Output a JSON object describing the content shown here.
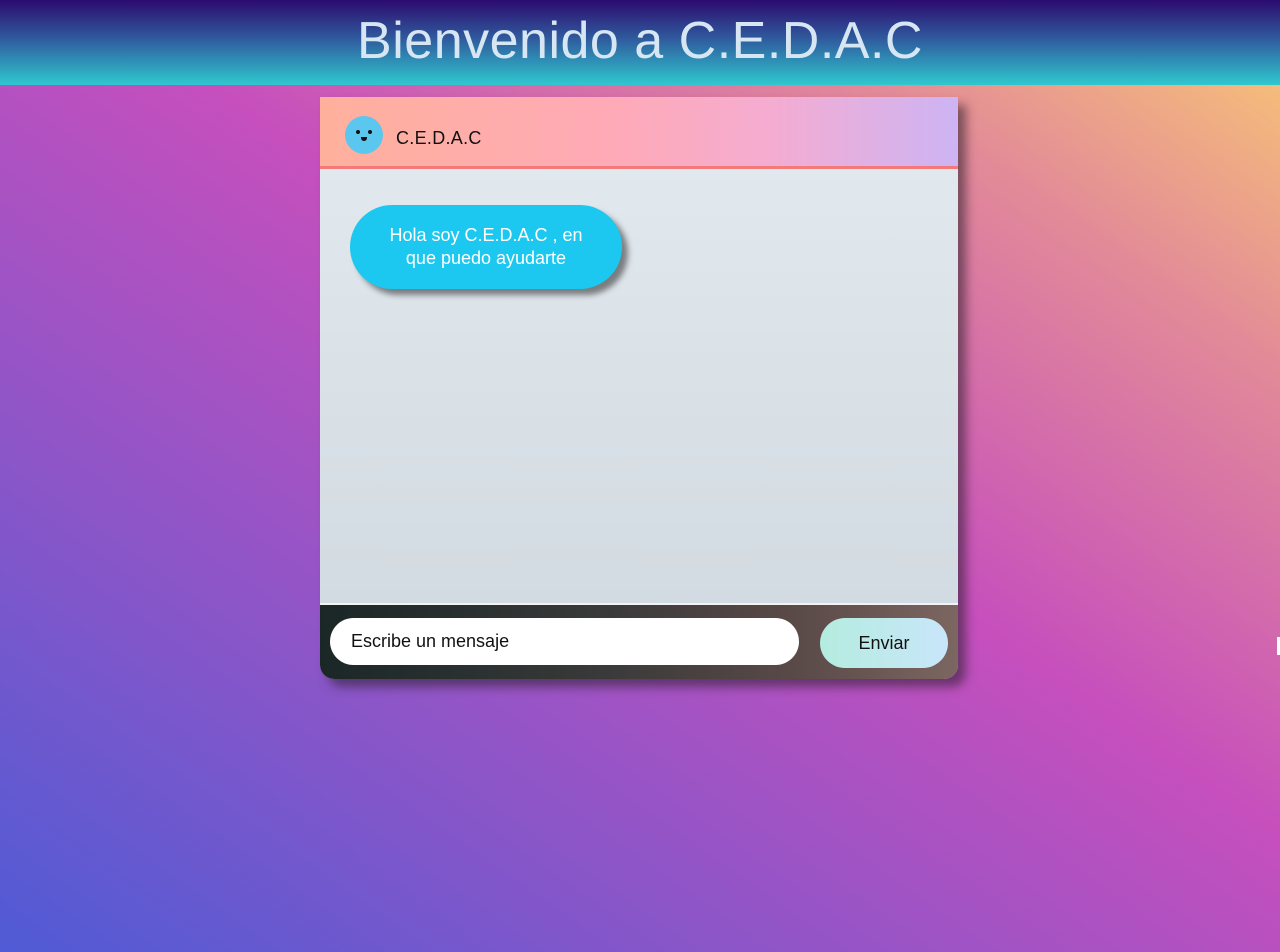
{
  "page": {
    "title": "Bienvenido a C.E.D.A.C"
  },
  "chat": {
    "header": {
      "bot_name": "C.E.D.A.C",
      "avatar_icon": "robot-face-icon"
    },
    "messages": [
      {
        "sender": "bot",
        "text": "Hola soy C.E.D.A.C , en que puedo ayudarte"
      }
    ],
    "input": {
      "placeholder": "Escribe un mensaje",
      "value": ""
    },
    "send_label": "Enviar"
  },
  "colors": {
    "bubble": "#1cc8ef",
    "header_border": "#f47a7a",
    "title_text": "#d7e6f3"
  }
}
